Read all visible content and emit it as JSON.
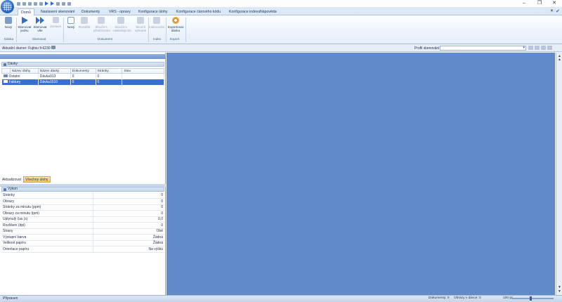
{
  "window": {
    "title": ""
  },
  "quick_access": {
    "icons": [
      "new-icon",
      "open-icon",
      "save-icon",
      "undo-icon",
      "redo-icon",
      "scan-one-icon",
      "scan-all-icon",
      "stop-icon",
      "print-icon",
      "dropdown-icon"
    ]
  },
  "tabs": [
    {
      "label": "Domů",
      "active": true
    },
    {
      "label": "Nastavení skenování"
    },
    {
      "label": "Dokumenty"
    },
    {
      "label": "VRS - opravy"
    },
    {
      "label": "Konfigurace úlohy"
    },
    {
      "label": "Konfigurace čárového kódu"
    },
    {
      "label": "Konfigurace indexu"
    },
    {
      "label": "Nápověda"
    }
  ],
  "ribbon": {
    "new_job": "Nový",
    "scan_one": "Skenovat jednu",
    "scan_all": "Skenovat vše",
    "stop": "Zastavit",
    "new_doc": "Nový",
    "split": "Rozdělit",
    "merge_prev": "Sloučit s předchozím",
    "merge_next": "Sloučit s následujícím",
    "merge_selected": "Sloučit vybrané",
    "indexing": "Indexování",
    "export_job": "Exportovat dávku",
    "groups": {
      "job": "Dávka",
      "scan": "Skenovat",
      "document": "Dokument",
      "index": "Index",
      "export": "Export"
    }
  },
  "scanner": {
    "label": "Aktuální skener: Fujitsu fi-6230"
  },
  "profile": {
    "label": "Profil skenování:",
    "value": ""
  },
  "jobs": {
    "title": "Dávky",
    "columns": [
      "Název úlohy",
      "Název dávky",
      "Dokumenty",
      "Stránky",
      "Stav"
    ],
    "rows": [
      {
        "job": "Ostatní",
        "batch": "Dávka913",
        "docs": "0",
        "pages": "0",
        "state": "",
        "selected": false
      },
      {
        "job": "Faktury",
        "batch": "Dávka1510",
        "docs": "0",
        "pages": "0",
        "state": "",
        "selected": true
      }
    ],
    "refresh": "Aktualizovat",
    "all_jobs": "Všechny úlohy"
  },
  "performance": {
    "title": "Výkon",
    "rows": [
      {
        "k": "Stránky",
        "v": "0"
      },
      {
        "k": "Obrazy",
        "v": "0"
      },
      {
        "k": "Stránky za minutu (ppm)",
        "v": "0"
      },
      {
        "k": "Obrazy za minutu (ipm)",
        "v": "0"
      },
      {
        "k": "Uplynulý čas (s)",
        "v": "0,0"
      },
      {
        "k": "Rozlišení (dpi)",
        "v": "0"
      },
      {
        "k": "Strany",
        "v": "Obě"
      },
      {
        "k": "Výstupní barva",
        "v": "Žádná"
      },
      {
        "k": "Velikost papíru",
        "v": "Žádná"
      },
      {
        "k": "Orientace papíru",
        "v": "Na výšku"
      }
    ]
  },
  "status": {
    "text": "Připraven",
    "docs_in_batch": "Dokumenty: 0",
    "images_in_batch": "Obrazy v dávce: 0",
    "zoom": "100 pc"
  }
}
